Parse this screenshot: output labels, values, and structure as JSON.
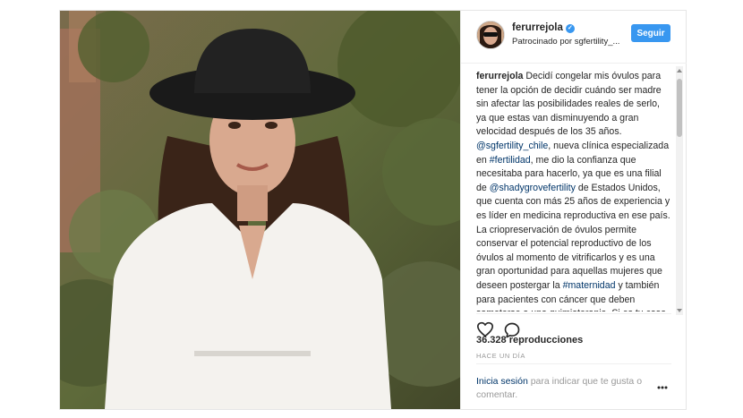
{
  "header": {
    "username": "ferurrejola",
    "sponsored": "Patrocinado por sgfertility_...",
    "follow_label": "Seguir"
  },
  "caption": {
    "author": "ferurrejola",
    "part1": "Decidí congelar mis óvulos para tener la opción de decidir cuándo ser madre sin afectar las posibilidades reales de serlo, ya que estas van disminuyendo a gran velocidad después de los 35 años. ",
    "mention1": "@sgfertility_chile",
    "part2": ", nueva clínica especializada en ",
    "hashtag1": "#fertilidad",
    "part3": ", me dio la confianza que necesitaba para hacerlo, ya que es una filial de ",
    "mention2": "@shadygrovefertility",
    "part4": " de Estados Unidos, que cuenta con más 25 años de experiencia y es líder en medicina reproductiva en ese país.",
    "part5": "La criopreservación de óvulos permite conservar el potencial reproductivo de los óvulos al momento de vitrificarlos y es una gran oportunidad para aquellas mujeres que deseen postergar la ",
    "hashtag2": "#maternidad",
    "part6": " y también para pacientes con cáncer que deben someterse a una quimioterapia. Si es tu caso, conoce www.sgfertility.cl que tiene"
  },
  "stats": {
    "views": "36.328 reproducciones",
    "time": "HACE UN DÍA"
  },
  "login": {
    "link": "Inicia sesión",
    "text": " para indicar que te gusta o comentar."
  },
  "more_label": "ooo",
  "icons": {
    "like": "heart-icon",
    "comment": "comment-icon",
    "verified": "verified-badge-icon",
    "more": "more-options-icon"
  },
  "colors": {
    "accent": "#3897f0",
    "link": "#003569",
    "muted": "#999999"
  }
}
